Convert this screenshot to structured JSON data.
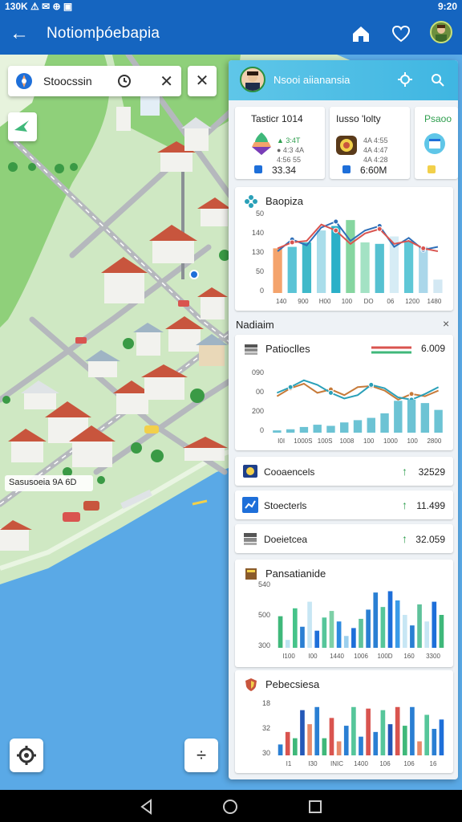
{
  "status_bar": {
    "time_left": "130K ⚠ ✉ ⊕ ▣",
    "time_right": "9:20"
  },
  "app_bar": {
    "title": "Notiomþóebapia"
  },
  "map": {
    "search": {
      "text": "Stoocssin"
    },
    "label": "Sasusoeia 9A 6D"
  },
  "panel": {
    "header_title": "Nsooi aiianansia",
    "mini_cards": [
      {
        "title": "Tasticr 1014",
        "sub1": "▲ 3:4T",
        "sub2": "● 4:3 4A",
        "sub3": "4:56 55",
        "value": "33.34"
      },
      {
        "title": "Iusso 'lolty",
        "sub1": "4A 4:55",
        "sub2": "4A 4:47",
        "sub3": "4A 4:28",
        "value": "6:60M"
      },
      {
        "title": "Psaoo",
        "value": ""
      }
    ],
    "chart1": {
      "title": "Baopiza"
    },
    "section_label": "Nadiaim",
    "section_close": "×",
    "chart2": {
      "title": "Patioclles",
      "value": "6.009"
    },
    "list": [
      {
        "title": "Cooaencels",
        "arrow": "↑",
        "value": "32529"
      },
      {
        "title": "Stoecterls",
        "arrow": "↑",
        "value": "11.499"
      },
      {
        "title": "Doeietcea",
        "arrow": "↑",
        "value": "32.059"
      }
    ],
    "chart3": {
      "title": "Pansatianide"
    },
    "chart4": {
      "title": "Pebecsiesa"
    }
  },
  "chart_data": [
    {
      "type": "bar",
      "name": "Baopiza",
      "categories": [
        "140",
        "900",
        "H00",
        "100",
        "DO",
        "06",
        "1200",
        "1480"
      ],
      "series": [
        {
          "name": "bars",
          "values": [
            60,
            62,
            68,
            84,
            90,
            98,
            68,
            66,
            76,
            70,
            62,
            18
          ],
          "colors": [
            "#f4a36c",
            "#5bc4d6",
            "#3fb9c9",
            "#a9ddea",
            "#2bb0c8",
            "#86d6a0",
            "#a3e2c4",
            "#56c1d1",
            "#d6ecf5",
            "#5fc7d6",
            "#aad7ea",
            "#d3e8f3"
          ]
        },
        {
          "name": "line1",
          "values": [
            56,
            72,
            64,
            88,
            96,
            70,
            84,
            90,
            62,
            74,
            58,
            62
          ],
          "color": "#2f6fb8"
        },
        {
          "name": "line2",
          "values": [
            60,
            68,
            70,
            92,
            84,
            66,
            80,
            86,
            66,
            70,
            60,
            56
          ],
          "color": "#d9544f"
        }
      ],
      "y_ticks": [
        "50",
        "140",
        "130",
        "50",
        "0"
      ],
      "ylim": [
        0,
        110
      ]
    },
    {
      "type": "line",
      "name": "Patioclles",
      "categories": [
        "I0I",
        "1000S",
        "100S",
        "1008",
        "100",
        "1000",
        "100",
        "2800"
      ],
      "series": [
        {
          "name": "line1",
          "values": [
            64,
            78,
            86,
            70,
            76,
            66,
            80,
            82,
            74,
            58,
            68,
            64,
            74
          ],
          "color": "#c77b3a"
        },
        {
          "name": "line2",
          "values": [
            70,
            80,
            92,
            84,
            70,
            60,
            66,
            84,
            78,
            62,
            58,
            68,
            80
          ],
          "color": "#2aa0b8"
        },
        {
          "name": "bars",
          "values": [
            4,
            6,
            10,
            14,
            12,
            18,
            22,
            26,
            34,
            56,
            58,
            52,
            40
          ],
          "color": "#6cc3d4"
        }
      ],
      "y_ticks": [
        "090",
        "00",
        "200",
        "0"
      ],
      "ylim": [
        0,
        110
      ]
    },
    {
      "type": "bar",
      "name": "Pansatianide",
      "categories": [
        "I100",
        "I00",
        "1440",
        "1006",
        "100D",
        "160",
        "3300"
      ],
      "series": [
        {
          "name": "bars",
          "values": [
            48,
            12,
            60,
            32,
            70,
            26,
            46,
            56,
            40,
            18,
            30,
            44,
            58,
            84,
            62,
            86,
            72,
            50,
            34,
            66,
            40,
            70,
            50
          ],
          "colors": [
            "#3fb87a",
            "#bde3f2",
            "#46c48a",
            "#2a7fd3",
            "#c7e6f4",
            "#1e6fd9",
            "#56c69a",
            "#7ed0a7",
            "#2d8ae0",
            "#9cd0ee",
            "#1e6fd9",
            "#5fc29b",
            "#2a7fd3",
            "#2a7fd3",
            "#56c69a",
            "#1e6fd9",
            "#3a9ae8",
            "#c7e6f4",
            "#2a7fd3",
            "#5fc29b",
            "#c7e6f4",
            "#1e6fd9",
            "#3fb87a"
          ]
        }
      ],
      "y_ticks": [
        "540",
        "500",
        "300"
      ],
      "ylim": [
        0,
        100
      ]
    },
    {
      "type": "bar",
      "name": "Pebecsiesa",
      "categories": [
        "I1",
        "I30",
        "INIC",
        "1400",
        "106",
        "106",
        "16"
      ],
      "series": [
        {
          "name": "bars",
          "values": [
            14,
            30,
            22,
            58,
            40,
            62,
            22,
            48,
            18,
            38,
            62,
            24,
            60,
            30,
            58,
            40,
            62,
            38,
            62,
            18,
            52,
            34,
            46
          ],
          "colors": [
            "#2a7fd3",
            "#d9544f",
            "#3fb87a",
            "#2458b8",
            "#e88a6a",
            "#2a7fd3",
            "#3fb87a",
            "#d9544f",
            "#e88a6a",
            "#2a7fd3",
            "#56c69a",
            "#2a7fd3",
            "#d9544f",
            "#2a7fd3",
            "#56c69a",
            "#2458b8",
            "#d9544f",
            "#3fb87a",
            "#2a7fd3",
            "#e88a6a",
            "#56c69a",
            "#2a7fd3",
            "#1e6fd9"
          ]
        }
      ],
      "y_ticks": [
        "18",
        "32",
        "30"
      ],
      "ylim": [
        0,
        70
      ]
    }
  ]
}
